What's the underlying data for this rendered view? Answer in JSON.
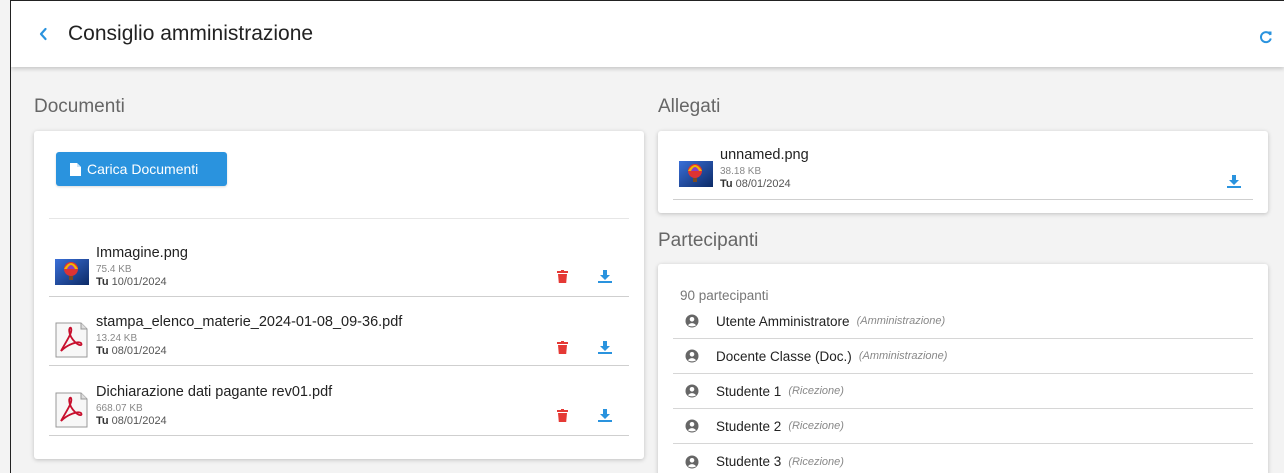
{
  "header": {
    "title": "Consiglio amministrazione"
  },
  "documents": {
    "section_title": "Documenti",
    "upload_label": "Carica Documenti",
    "files": [
      {
        "name": "Immagine.png",
        "size": "75.4 KB",
        "owner": "Tu",
        "date": "10/01/2024",
        "type": "image"
      },
      {
        "name": "stampa_elenco_materie_2024-01-08_09-36.pdf",
        "size": "13.24 KB",
        "owner": "Tu",
        "date": "08/01/2024",
        "type": "pdf"
      },
      {
        "name": "Dichiarazione dati pagante rev01.pdf",
        "size": "668.07 KB",
        "owner": "Tu",
        "date": "08/01/2024",
        "type": "pdf"
      }
    ]
  },
  "attachments": {
    "section_title": "Allegati",
    "files": [
      {
        "name": "unnamed.png",
        "size": "38.18 KB",
        "owner": "Tu",
        "date": "08/01/2024",
        "type": "image"
      }
    ]
  },
  "participants": {
    "section_title": "Partecipanti",
    "count_label": "90 partecipanti",
    "items": [
      {
        "name": "Utente Amministratore",
        "role": "(Amministrazione)"
      },
      {
        "name": "Docente Classe (Doc.)",
        "role": "(Amministrazione)"
      },
      {
        "name": "Studente 1",
        "role": "(Ricezione)"
      },
      {
        "name": "Studente 2",
        "role": "(Ricezione)"
      },
      {
        "name": "Studente 3",
        "role": "(Ricezione)"
      }
    ]
  },
  "colors": {
    "accent": "#2a93de",
    "delete": "#e53935",
    "icon_gray": "#666666"
  }
}
